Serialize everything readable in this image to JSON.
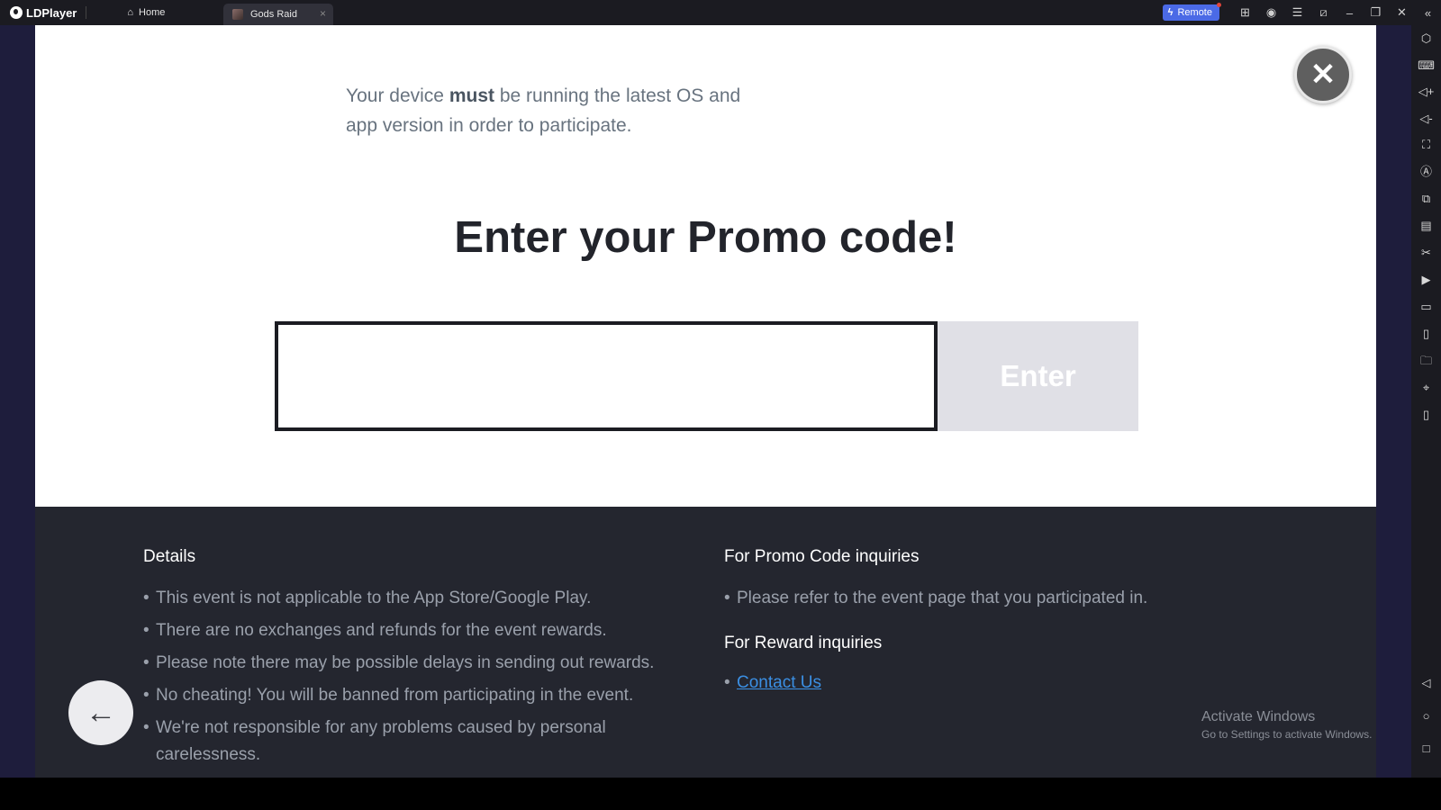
{
  "titlebar": {
    "app_name": "LDPlayer",
    "tabs": [
      {
        "label": "Home",
        "icon": "home-icon"
      },
      {
        "label": "Gods Raid",
        "icon": "game-thumbnail",
        "close": "×"
      }
    ],
    "remote_label": "Remote",
    "icons": [
      "gamepad-icon",
      "account-icon",
      "menu-icon",
      "resize-icon",
      "minimize-icon",
      "restore-icon",
      "close-icon",
      "collapse-sidebar-icon"
    ]
  },
  "dialog": {
    "notice_pre": "Your device ",
    "notice_bold": "must",
    "notice_post": " be running the latest OS and app version in order to participate.",
    "title": "Enter your Promo code!",
    "input_value": "",
    "input_placeholder": "",
    "enter_label": "Enter",
    "close_glyph": "✕"
  },
  "details": {
    "title": "Details",
    "items": [
      "This event is not applicable to the App Store/Google Play.",
      "There are no exchanges and refunds for the event rewards.",
      "Please note there may be possible delays in sending out rewards.",
      "No cheating! You will be banned from participating in the event.",
      "We're not responsible for any problems caused by personal carelessness."
    ]
  },
  "promo_inquiries": {
    "title": "For Promo Code inquiries",
    "items": [
      "Please refer to the event page that you participated in."
    ]
  },
  "reward_inquiries": {
    "title": "For Reward inquiries",
    "link_label": "Contact Us"
  },
  "watermark": {
    "line1": "Activate Windows",
    "line2": "Go to Settings to activate Windows."
  },
  "sidebar": {
    "items": [
      {
        "name": "settings-icon",
        "glyph": "⬡"
      },
      {
        "name": "keyboard-icon",
        "glyph": "⌨"
      },
      {
        "name": "volume-up-icon",
        "glyph": "◁+"
      },
      {
        "name": "volume-down-icon",
        "glyph": "◁-"
      },
      {
        "name": "fullscreen-icon",
        "glyph": "⛶"
      },
      {
        "name": "auto-rotate-icon",
        "glyph": "Ⓐ"
      },
      {
        "name": "add-instance-icon",
        "glyph": "⧉"
      },
      {
        "name": "apk-install-icon",
        "glyph": "▤"
      },
      {
        "name": "scissors-icon",
        "glyph": "✂"
      },
      {
        "name": "record-icon",
        "glyph": "▶"
      },
      {
        "name": "sync-icon",
        "glyph": "▭"
      },
      {
        "name": "shake-icon",
        "glyph": "▯"
      },
      {
        "name": "folder-icon",
        "glyph": "🗀"
      },
      {
        "name": "location-icon",
        "glyph": "⌖"
      },
      {
        "name": "rotate-icon",
        "glyph": "▯"
      }
    ],
    "nav": [
      {
        "name": "back-nav-icon",
        "glyph": "◁"
      },
      {
        "name": "home-nav-icon",
        "glyph": "○"
      },
      {
        "name": "recents-nav-icon",
        "glyph": "□"
      }
    ]
  },
  "back_button_glyph": "←"
}
